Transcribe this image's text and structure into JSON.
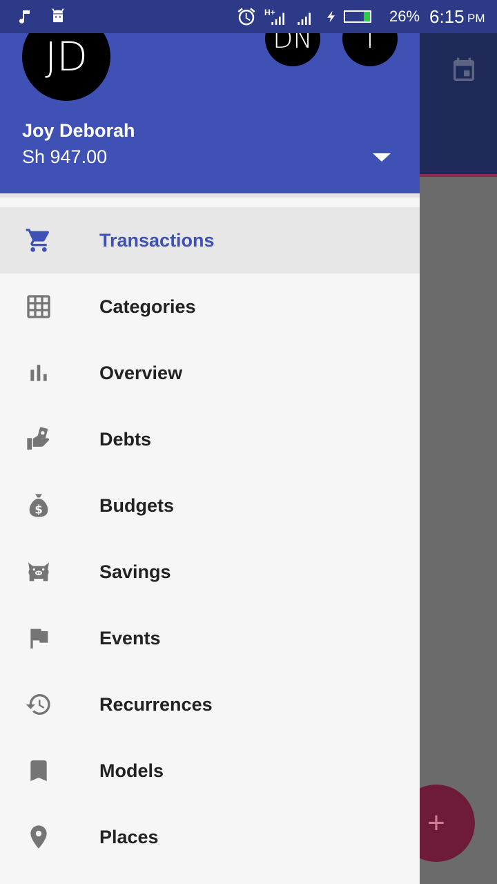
{
  "status_bar": {
    "battery_percent": "26%",
    "time": "6:15",
    "ampm": "PM",
    "network": "H+",
    "battery_level": 0.26
  },
  "account": {
    "avatar_initials": "JD",
    "other_accounts": [
      "DN",
      "T"
    ],
    "name": "Joy Deborah",
    "balance": "Sh 947.00"
  },
  "menu": [
    {
      "label": "Transactions",
      "icon": "cart-icon",
      "active": true
    },
    {
      "label": "Categories",
      "icon": "grid-icon"
    },
    {
      "label": "Overview",
      "icon": "bar-chart-icon"
    },
    {
      "label": "Debts",
      "icon": "money-hand-icon"
    },
    {
      "label": "Budgets",
      "icon": "money-bag-icon"
    },
    {
      "label": "Savings",
      "icon": "piggy-bank-icon"
    },
    {
      "label": "Events",
      "icon": "flag-icon"
    },
    {
      "label": "Recurrences",
      "icon": "history-icon"
    },
    {
      "label": "Models",
      "icon": "bookmark-icon"
    },
    {
      "label": "Places",
      "icon": "place-icon"
    }
  ],
  "colors": {
    "primary": "#3f51b5",
    "status_bar": "#2c3a88",
    "icon_gray": "#757575"
  }
}
